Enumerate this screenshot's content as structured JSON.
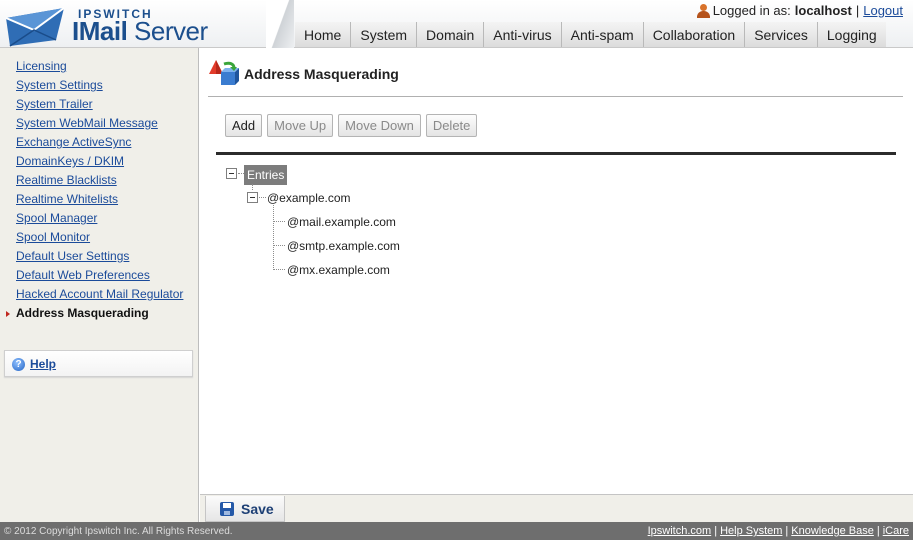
{
  "app": {
    "logo_small": "IPSWITCH",
    "logo_bold": "IMail",
    "logo_rest": " Server"
  },
  "login": {
    "prefix": "Logged in as:",
    "user": "localhost",
    "separator": "|",
    "logout": "Logout"
  },
  "nav": {
    "tabs": [
      {
        "label": "Home"
      },
      {
        "label": "System"
      },
      {
        "label": "Domain"
      },
      {
        "label": "Anti-virus"
      },
      {
        "label": "Anti-spam"
      },
      {
        "label": "Collaboration"
      },
      {
        "label": "Services"
      },
      {
        "label": "Logging"
      }
    ]
  },
  "sidebar": {
    "links": [
      {
        "label": "Licensing"
      },
      {
        "label": "System Settings"
      },
      {
        "label": "System Trailer"
      },
      {
        "label": "System WebMail Message"
      },
      {
        "label": "Exchange ActiveSync"
      },
      {
        "label": "DomainKeys / DKIM"
      },
      {
        "label": "Realtime Blacklists"
      },
      {
        "label": "Realtime Whitelists"
      },
      {
        "label": "Spool Manager"
      },
      {
        "label": "Spool Monitor"
      },
      {
        "label": "Default User Settings"
      },
      {
        "label": "Default Web Preferences"
      },
      {
        "label": "Hacked Account Mail Regulator"
      },
      {
        "label": "Address Masquerading"
      }
    ],
    "help": "Help"
  },
  "main": {
    "title": "Address Masquerading",
    "toolbar": {
      "add": "Add",
      "move_up": "Move Up",
      "move_down": "Move Down",
      "delete": "Delete"
    },
    "tree": {
      "root": "Entries",
      "domain": "@example.com",
      "children": [
        "@mail.example.com",
        "@smtp.example.com",
        "@mx.example.com"
      ]
    }
  },
  "savebar": {
    "save": "Save"
  },
  "footer": {
    "copyright": "© 2012 Copyright Ipswitch Inc. All Rights Reserved.",
    "links": [
      "Ipswitch.com",
      "Help System",
      "Knowledge Base",
      "iCare"
    ],
    "separator": "|"
  }
}
